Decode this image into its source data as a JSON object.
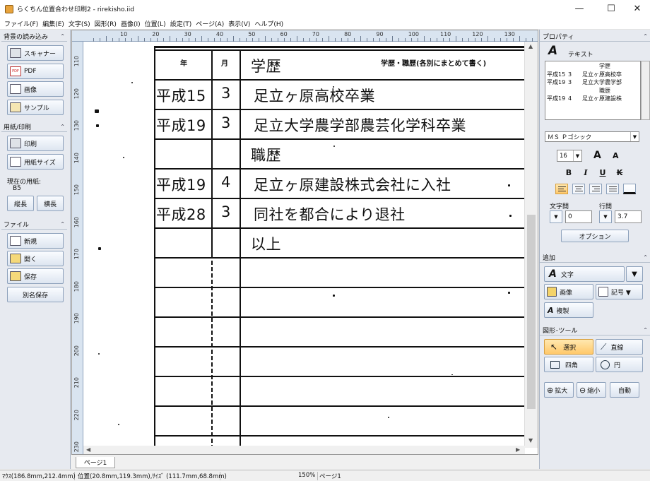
{
  "window": {
    "title": "らくちん位置合わせ印刷2 - rirekisho.iid",
    "minimize": "—",
    "maximize": "☐",
    "close": "✕"
  },
  "menu": [
    "ファイル(F)",
    "編集(E)",
    "文字(S)",
    "図形(R)",
    "画像(I)",
    "位置(L)",
    "設定(T)",
    "ページ(A)",
    "表示(V)",
    "ヘルプ(H)"
  ],
  "left": {
    "background_section": "背景の読み込み",
    "scanner": "スキャナー",
    "pdf": "PDF",
    "pdf_badge": "PDF",
    "image": "画像",
    "sample": "サンプル",
    "paper_section": "用紙/印刷",
    "print": "印刷",
    "paper_size": "用紙サイズ",
    "current_paper_label": "現在の用紙:",
    "current_paper": "B5",
    "portrait": "縦長",
    "landscape": "横長",
    "file_section": "ファイル",
    "new": "新規",
    "open": "開く",
    "save": "保存",
    "save_as": "別名保存",
    "collapse": "⌃"
  },
  "ruler": {
    "top": [
      "10",
      "20",
      "30",
      "40",
      "50",
      "60",
      "70",
      "80",
      "90",
      "100",
      "110",
      "120",
      "130"
    ],
    "left": [
      "110",
      "120",
      "130",
      "140",
      "150",
      "160",
      "170",
      "180",
      "190",
      "200",
      "210",
      "220",
      "230"
    ]
  },
  "scroll": {
    "up": "▲",
    "down": "▼",
    "left": "◀",
    "right": "▶"
  },
  "document": {
    "header": {
      "year": "年",
      "month": "月",
      "history": "学歴・職歴(各別にまとめて書く)"
    },
    "rows": [
      {
        "year": "",
        "month": "",
        "text": "学歴"
      },
      {
        "year": "平成15",
        "month": "3",
        "text": "足立ヶ原高校卒業"
      },
      {
        "year": "平成19",
        "month": "3",
        "text": "足立大学農学部農芸化学科卒業"
      },
      {
        "year": "",
        "month": "",
        "text": "職歴"
      },
      {
        "year": "平成19",
        "month": "4",
        "text": "足立ヶ原建設株式会社に入社"
      },
      {
        "year": "平成28",
        "month": "3",
        "text": "同社を都合により退社"
      },
      {
        "year": "",
        "month": "",
        "text": "以上"
      }
    ]
  },
  "tab": {
    "page": "ページ1"
  },
  "status": {
    "mouse": "ﾏｳｽ(186.8mm,212.4mm)",
    "position": "位置(20.8mm,119.3mm),ｻｲｽﾞ (111.7mm,68.8mm)",
    "zoom": "150%",
    "page": "ページ1"
  },
  "right": {
    "property_section": "プロパティ",
    "text_label": "テキスト",
    "list": [
      {
        "y": "",
        "m": "",
        "t": "学歴"
      },
      {
        "y": "平成15",
        "m": "3",
        "t": "足立ヶ原高校卒"
      },
      {
        "y": "平成19",
        "m": "3",
        "t": "足立大学農学部"
      },
      {
        "y": "",
        "m": "",
        "t": "職歴"
      },
      {
        "y": "平成19",
        "m": "4",
        "t": "足立ヶ原建設株"
      }
    ],
    "font": "ＭＳ Ｐゴシック",
    "size": "16",
    "grow": "A",
    "shrink": "A",
    "bold": "B",
    "italic": "I",
    "underline": "U",
    "strike": "K",
    "spacing_label": "文字間",
    "spacing": "0",
    "line_label": "行間",
    "line": "3.7",
    "options": "オプション",
    "add_section": "追加",
    "add_text": "文字",
    "add_image": "画像",
    "add_symbol": "記号 ▼",
    "duplicate": "複製",
    "tools_section": "図形･ツール",
    "select": "選択",
    "line_tool": "直線",
    "rect": "四角",
    "circle": "円",
    "zoom_in": "拡大",
    "zoom_out": "縮小",
    "auto": "自動",
    "big_a": "A",
    "collapse": "⌃",
    "down": "▼",
    "dropdown_arrow": "▼"
  },
  "colors": {
    "accent": "#ffc86a",
    "panel": "#e7eaf0",
    "ruler": "#d9e4f0"
  }
}
